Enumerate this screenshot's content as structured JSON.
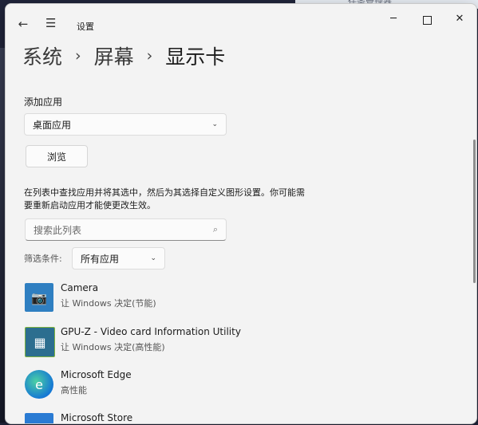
{
  "background": {
    "taskmgr_title": "任务管理器"
  },
  "window": {
    "title": "设置",
    "back_glyph": "←",
    "menu_glyph": "☰",
    "min_glyph": "─",
    "close_glyph": "✕"
  },
  "breadcrumb": {
    "items": [
      "系统",
      "屏幕",
      "显示卡"
    ],
    "separator": "›"
  },
  "add_app": {
    "label": "添加应用",
    "selected": "桌面应用",
    "chevron": "⌄"
  },
  "browse_label": "浏览",
  "description_line1": "在列表中查找应用并将其选中，然后为其选择自定义图形设置。你可能需",
  "description_line2": "要重新启动应用才能使更改生效。",
  "search": {
    "placeholder": "搜索此列表",
    "icon": "⌕"
  },
  "filter": {
    "label": "筛选条件:",
    "selected": "所有应用",
    "chevron": "⌄"
  },
  "apps": [
    {
      "name": "Camera",
      "status": "让 Windows 决定(节能)",
      "icon_glyph": "📷",
      "icon": "camera-icon"
    },
    {
      "name": "GPU-Z - Video card Information Utility",
      "status": "让 Windows 决定(高性能)",
      "icon_glyph": "▦",
      "icon": "gpu-z-icon"
    },
    {
      "name": "Microsoft Edge",
      "status": "高性能",
      "icon_glyph": "e",
      "icon": "edge-icon"
    },
    {
      "name": "Microsoft Store",
      "status": "",
      "icon_glyph": "▣",
      "icon": "store-icon"
    }
  ]
}
